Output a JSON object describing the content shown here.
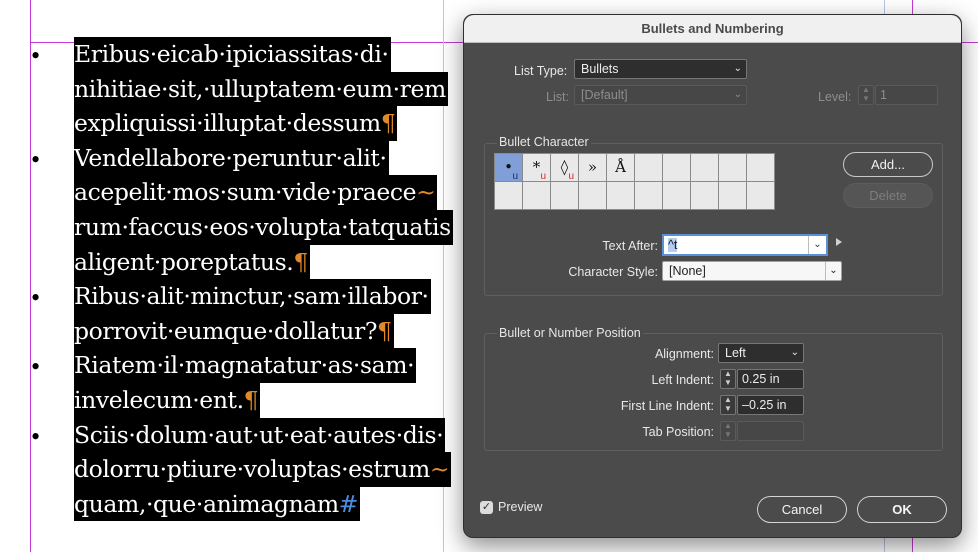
{
  "document": {
    "lines": [
      {
        "bullet": "•",
        "text": "Eribus·eicab·ipiciassitas·di·",
        "mark": ""
      },
      {
        "bullet": "",
        "text": "nihitiae·sit,·ulluptatem·eum·rem",
        "mark": ""
      },
      {
        "bullet": "",
        "text": "expliquissi·illuptat·dessum",
        "mark": "¶"
      },
      {
        "bullet": "•",
        "text": "Vendellabore·peruntur·alit·",
        "mark": ""
      },
      {
        "bullet": "",
        "text": "acepelit·mos·sum·vide·praece",
        "mark": "~"
      },
      {
        "bullet": "",
        "text": "rum·faccus·eos·volupta·tatquatis",
        "mark": ""
      },
      {
        "bullet": "",
        "text": "aligent·poreptatus.",
        "mark": "¶"
      },
      {
        "bullet": "•",
        "text": "Ribus·alit·minctur,·sam·illabor·",
        "mark": ""
      },
      {
        "bullet": "",
        "text": "porrovit·eumque·dollatur?",
        "mark": "¶"
      },
      {
        "bullet": "•",
        "text": "Riatem·il·magnatatur·as·sam·",
        "mark": ""
      },
      {
        "bullet": "",
        "text": "invelecum·ent.",
        "mark": "¶"
      },
      {
        "bullet": "•",
        "text": "Sciis·dolum·aut·ut·eat·autes·dis·",
        "mark": ""
      },
      {
        "bullet": "",
        "text": "dolorru·ptiure·voluptas·estrum",
        "mark": "~"
      },
      {
        "bullet": "",
        "text": "quam,·que·animagnam",
        "mark": "#"
      }
    ]
  },
  "dialog": {
    "title": "Bullets and Numbering",
    "list_type_label": "List Type:",
    "list_type_value": "Bullets",
    "list_label": "List:",
    "list_value": "[Default]",
    "level_label": "Level:",
    "level_value": "1",
    "bullet_character": {
      "title": "Bullet Character",
      "glyphs": [
        "•",
        "*",
        "◊",
        "»",
        "Å",
        "",
        "",
        "",
        "",
        "",
        "",
        "",
        "",
        "",
        "",
        "",
        "",
        "",
        "",
        ""
      ],
      "underline_glyph": "u",
      "add_label": "Add...",
      "delete_label": "Delete",
      "text_after_label": "Text After:",
      "text_after_value": "^t",
      "char_style_label": "Character Style:",
      "char_style_value": "[None]"
    },
    "position": {
      "title": "Bullet or Number Position",
      "alignment_label": "Alignment:",
      "alignment_value": "Left",
      "left_indent_label": "Left Indent:",
      "left_indent_value": "0.25 in",
      "first_line_label": "First Line Indent:",
      "first_line_value": "–0.25 in",
      "tab_position_label": "Tab Position:",
      "tab_position_value": ""
    },
    "preview_label": "Preview",
    "preview_checked": true,
    "cancel_label": "Cancel",
    "ok_label": "OK"
  }
}
